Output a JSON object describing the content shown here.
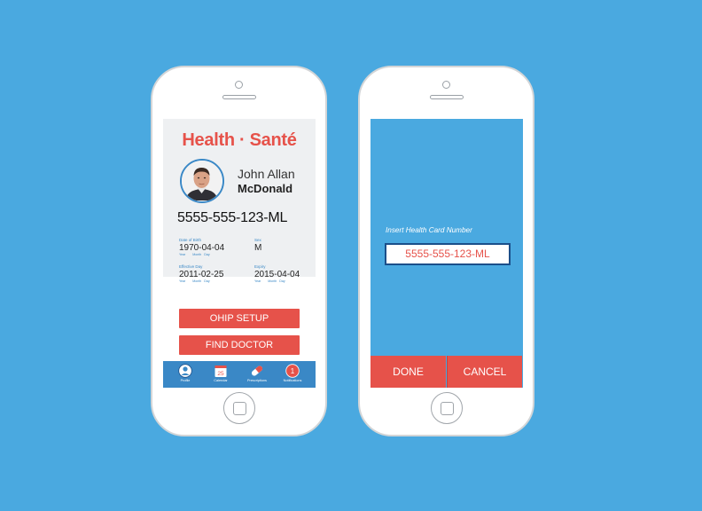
{
  "card_screen": {
    "brand": "Health · Santé",
    "first_name": "John Allan",
    "last_name": "McDonald",
    "card_number": "5555-555-123-ML",
    "fields": {
      "dob": {
        "label": "Date of Birth",
        "value": "1970-04-04",
        "sub": "Year        Month   Day"
      },
      "sex": {
        "label": "Sex",
        "value": "M"
      },
      "effective": {
        "label": "Effective Day",
        "value": "2011-02-25",
        "sub": "Year        Month   Day"
      },
      "expiry": {
        "label": "Expiry",
        "value": "2015-04-04",
        "sub": "Year        Month   Day"
      }
    },
    "buttons": {
      "ohip": "OHIP SETUP",
      "doctor": "FIND DOCTOR"
    },
    "tabs": [
      {
        "label": "Profile",
        "icon": "profile-icon"
      },
      {
        "label": "Calendar",
        "icon": "calendar-icon",
        "badge": "25"
      },
      {
        "label": "Prescriptions",
        "icon": "pill-icon"
      },
      {
        "label": "Notifications",
        "icon": "notification-icon",
        "badge": "1"
      }
    ]
  },
  "insert_screen": {
    "label": "Insert Health Card Number",
    "value": "5555-555-123-ML",
    "done": "DONE",
    "cancel": "CANCEL"
  },
  "colors": {
    "background": "#4aa9e0",
    "accent_red": "#e6524a",
    "tab_blue": "#3a88c6"
  }
}
